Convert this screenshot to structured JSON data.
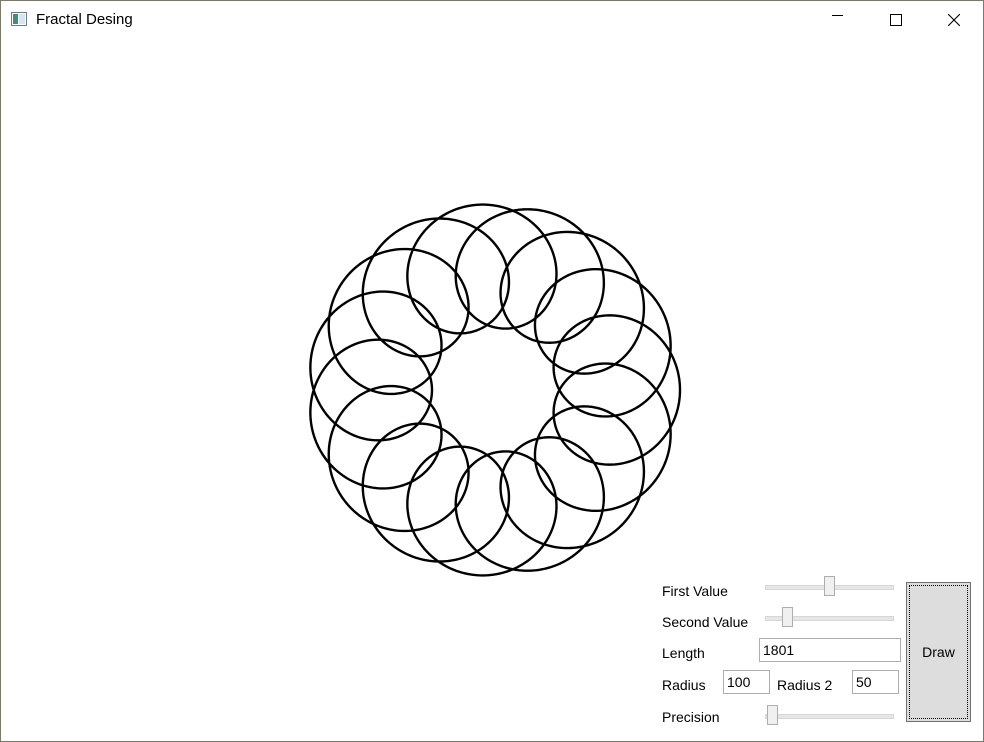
{
  "window": {
    "title": "Fractal Desing",
    "icons": {
      "app": "app-window-icon",
      "minimize": "minimize-icon",
      "maximize": "maximize-icon",
      "close": "close-icon"
    }
  },
  "controls": {
    "first_value": {
      "label": "First Value",
      "slider_fraction": 0.5
    },
    "second_value": {
      "label": "Second Value",
      "slider_fraction": 0.14
    },
    "length": {
      "label": "Length",
      "value": "1801"
    },
    "radius": {
      "label": "Radius",
      "value": "100"
    },
    "radius2": {
      "label": "Radius 2",
      "value": "50"
    },
    "precision": {
      "label": "Precision",
      "slider_fraction": 0.02
    },
    "draw_button": {
      "label": "Draw"
    }
  },
  "drawing": {
    "stroke_color": "#000000",
    "radius": 100,
    "radius2": 50,
    "loops": 16
  }
}
